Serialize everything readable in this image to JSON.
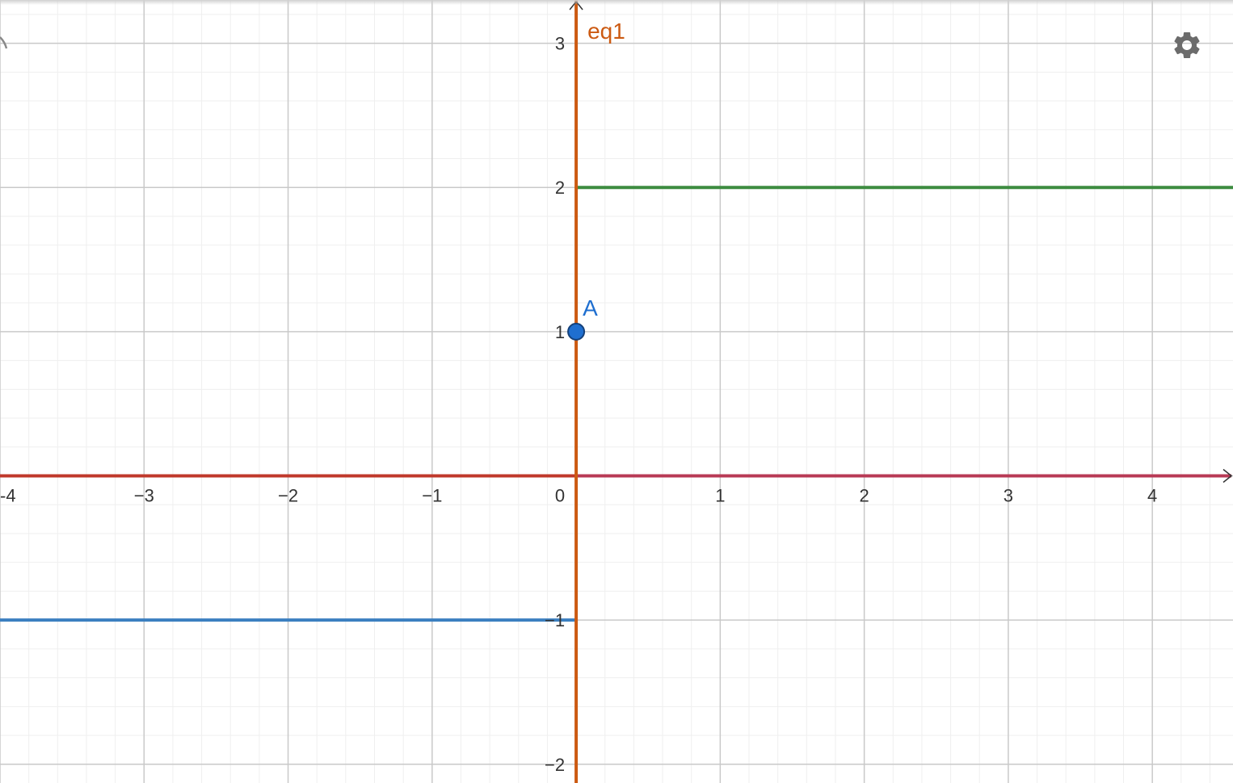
{
  "view": {
    "xmin": -4.0,
    "xmax": 4.56,
    "ymin": -2.13,
    "ymax": 3.3,
    "major_step": 1,
    "minor_per_major": 5
  },
  "colors": {
    "minor_grid": "#efefef",
    "major_grid": "#c9c9c9",
    "x_axis_left": "#c0392b",
    "x_axis_right": "#b83a55",
    "y_axis": "#cc5a12",
    "line_y2": "#3d8c40",
    "line_ym1": "#3b7fc0",
    "point_fill": "#1f6fd0",
    "point_stroke": "#15417a",
    "label_eq1": "#cc5a12",
    "label_A": "#1f6fd0",
    "settings": "#6b6b6b"
  },
  "x_ticks": [
    {
      "v": -4,
      "t": "-4"
    },
    {
      "v": -3,
      "t": "−3"
    },
    {
      "v": -2,
      "t": "−2"
    },
    {
      "v": -1,
      "t": "−1"
    },
    {
      "v": 1,
      "t": "1"
    },
    {
      "v": 2,
      "t": "2"
    },
    {
      "v": 3,
      "t": "3"
    },
    {
      "v": 4,
      "t": "4"
    }
  ],
  "y_ticks": [
    {
      "v": 3,
      "t": "3"
    },
    {
      "v": 2,
      "t": "2"
    },
    {
      "v": 1,
      "t": "1"
    },
    {
      "v": -1,
      "t": "−1"
    },
    {
      "v": -2,
      "t": "−2"
    }
  ],
  "origin_label": "0",
  "objects": {
    "eq1": {
      "label": "eq1",
      "x": 0
    },
    "line_y2": {
      "y": 2,
      "from_x": 0
    },
    "line_ym1": {
      "y": -1,
      "to_x": 0
    },
    "point_A": {
      "label": "A",
      "x": 0,
      "y": 1
    }
  },
  "settings_icon": "gear-icon"
}
